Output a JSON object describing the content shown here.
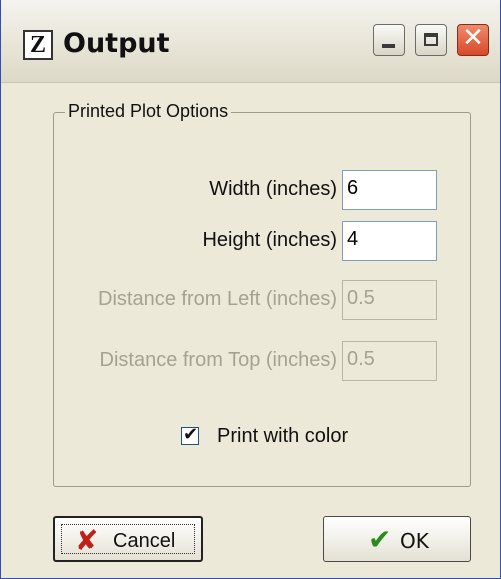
{
  "window": {
    "title": "Output",
    "app_icon": "Z"
  },
  "titlebar_buttons": {
    "close_glyph": "✕"
  },
  "group": {
    "legend": "Printed Plot Options",
    "fields": [
      {
        "label": "Width (inches)",
        "value": "6",
        "enabled": true
      },
      {
        "label": "Height (inches)",
        "value": "4",
        "enabled": true
      },
      {
        "label": "Distance from Left (inches)",
        "value": "0.5",
        "enabled": false
      },
      {
        "label": "Distance from Top (inches)",
        "value": "0.5",
        "enabled": false
      }
    ],
    "checkbox": {
      "label": "Print with color",
      "checked": true,
      "mark": "✔"
    }
  },
  "buttons": {
    "cancel_label": "Cancel",
    "cancel_icon": "✘",
    "ok_label": "OK",
    "ok_icon": "✔"
  }
}
